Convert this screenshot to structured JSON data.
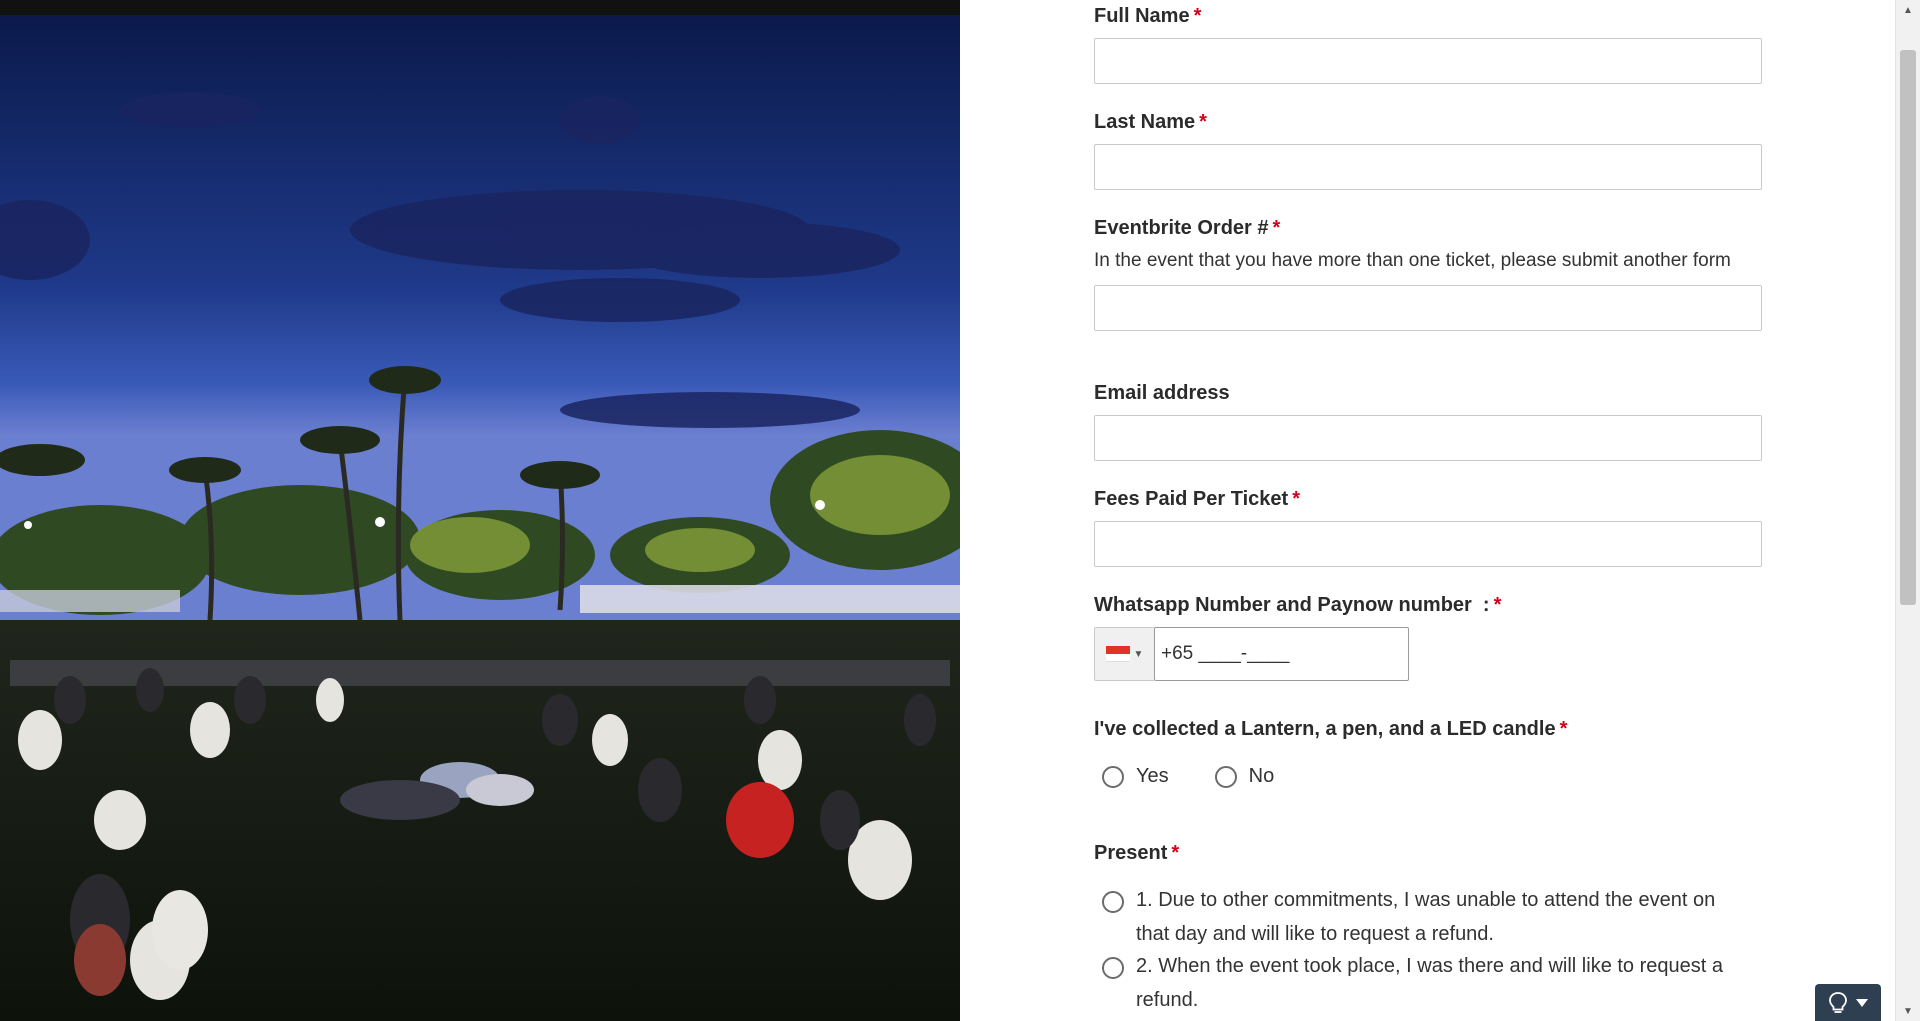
{
  "form": {
    "fields": [
      {
        "label": "Full Name",
        "required": true
      },
      {
        "label": "Last Name",
        "required": true
      },
      {
        "label": "Eventbrite Order #",
        "required": true,
        "description": "In the event that you have more than one ticket, please submit another form"
      },
      {
        "label": "Email address",
        "required": false
      },
      {
        "label": "Fees Paid Per Ticket",
        "required": true
      }
    ],
    "required_marker": "*",
    "phone": {
      "label": "Whatsapp Number and Paynow number  :",
      "required": true,
      "value": "+65 ____-____",
      "country": "SG"
    },
    "collected": {
      "label": "I've collected a Lantern, a pen, and a LED candle",
      "required": true,
      "options": [
        "Yes",
        "No"
      ]
    },
    "present": {
      "label": "Present",
      "required": true,
      "options": [
        "1. Due to other commitments, I was unable to attend the event on that day and will like to request a refund.",
        "2. When the event took place, I was there and will like to request a refund."
      ]
    }
  },
  "help_button": {
    "icon": "lightbulb-icon"
  },
  "colors": {
    "required": "#d0021b",
    "help_button": "#2f3f52"
  }
}
